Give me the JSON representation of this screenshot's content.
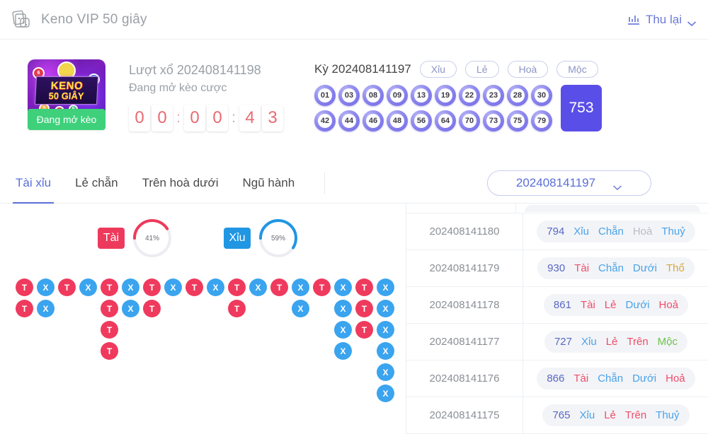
{
  "header": {
    "title": "Keno VIP 50 giây",
    "app_icon": "cards-dice-icon",
    "collapse_label": "Thu lại",
    "collapse_icon": "bar-chart-icon",
    "chevron_icon": "chevron-down-icon"
  },
  "draw": {
    "logo_line1": "KENO",
    "logo_line2": "50 GIÂY",
    "status_badge": "Đang mở kèo",
    "title": "Lượt xổ 202408141198",
    "subtitle": "Đang mở kèo cược",
    "timer": [
      "0",
      "0",
      ":",
      "0",
      "0",
      ":",
      "4",
      "3"
    ]
  },
  "result": {
    "period_label": "Kỳ 202408141197",
    "tags": [
      "Xỉu",
      "Lẻ",
      "Hoà",
      "Mộc"
    ],
    "balls_row1": [
      "01",
      "03",
      "08",
      "09",
      "13",
      "19",
      "22",
      "23",
      "28",
      "30"
    ],
    "balls_row2": [
      "42",
      "44",
      "46",
      "48",
      "56",
      "64",
      "70",
      "73",
      "75",
      "79"
    ],
    "sum": "753"
  },
  "tabs": [
    {
      "label": "Tài xỉu",
      "active": true
    },
    {
      "label": "Lẻ chẵn",
      "active": false
    },
    {
      "label": "Trên hoà dưới",
      "active": false
    },
    {
      "label": "Ngũ hành",
      "active": false
    }
  ],
  "period_select": {
    "value": "202408141197",
    "chevron_icon": "chevron-down-icon"
  },
  "stats": {
    "tai": {
      "label": "Tài",
      "percent": 41,
      "color": "#ed3a5c"
    },
    "xiu": {
      "label": "Xỉu",
      "percent": 59,
      "color": "#2196e3"
    }
  },
  "roadmap": {
    "columns": [
      [
        "T",
        "T"
      ],
      [
        "X",
        "X"
      ],
      [
        "T"
      ],
      [
        "X"
      ],
      [
        "T",
        "T",
        "T",
        "T"
      ],
      [
        "X",
        "X"
      ],
      [
        "T",
        "T"
      ],
      [
        "X"
      ],
      [
        "T"
      ],
      [
        "X"
      ],
      [
        "T",
        "T"
      ],
      [
        "X"
      ],
      [
        "T"
      ],
      [
        "X",
        "X"
      ],
      [
        "T"
      ],
      [
        "X",
        "X",
        "X",
        "X"
      ],
      [
        "T",
        "T",
        "T"
      ],
      [
        "X",
        "X",
        "X",
        "X",
        "X",
        "X"
      ]
    ]
  },
  "history": {
    "rows": [
      {
        "id": "202408141180",
        "num": "794",
        "tx": "Xỉu",
        "tx_c": "v-xiu",
        "lc": "Chẵn",
        "lc_c": "v-chan",
        "thd": "Hoà",
        "thd_c": "v-hoa",
        "nh": "Thuỷ",
        "nh_c": "v-thuy"
      },
      {
        "id": "202408141179",
        "num": "930",
        "tx": "Tài",
        "tx_c": "v-tai",
        "lc": "Chẵn",
        "lc_c": "v-chan",
        "thd": "Dưới",
        "thd_c": "v-duoi",
        "nh": "Thổ",
        "nh_c": "v-tho"
      },
      {
        "id": "202408141178",
        "num": "861",
        "tx": "Tài",
        "tx_c": "v-tai",
        "lc": "Lẻ",
        "lc_c": "v-le",
        "thd": "Dưới",
        "thd_c": "v-duoi",
        "nh": "Hoả",
        "nh_c": "v-hoa-e"
      },
      {
        "id": "202408141177",
        "num": "727",
        "tx": "Xỉu",
        "tx_c": "v-xiu",
        "lc": "Lẻ",
        "lc_c": "v-le",
        "thd": "Trên",
        "thd_c": "v-tren",
        "nh": "Mộc",
        "nh_c": "v-moc"
      },
      {
        "id": "202408141176",
        "num": "866",
        "tx": "Tài",
        "tx_c": "v-tai",
        "lc": "Chẵn",
        "lc_c": "v-chan",
        "thd": "Dưới",
        "thd_c": "v-duoi",
        "nh": "Hoả",
        "nh_c": "v-hoa-e"
      },
      {
        "id": "202408141175",
        "num": "765",
        "tx": "Xỉu",
        "tx_c": "v-xiu",
        "lc": "Lẻ",
        "lc_c": "v-le",
        "thd": "Trên",
        "thd_c": "v-tren",
        "nh": "Thuỷ",
        "nh_c": "v-thuy"
      }
    ]
  }
}
